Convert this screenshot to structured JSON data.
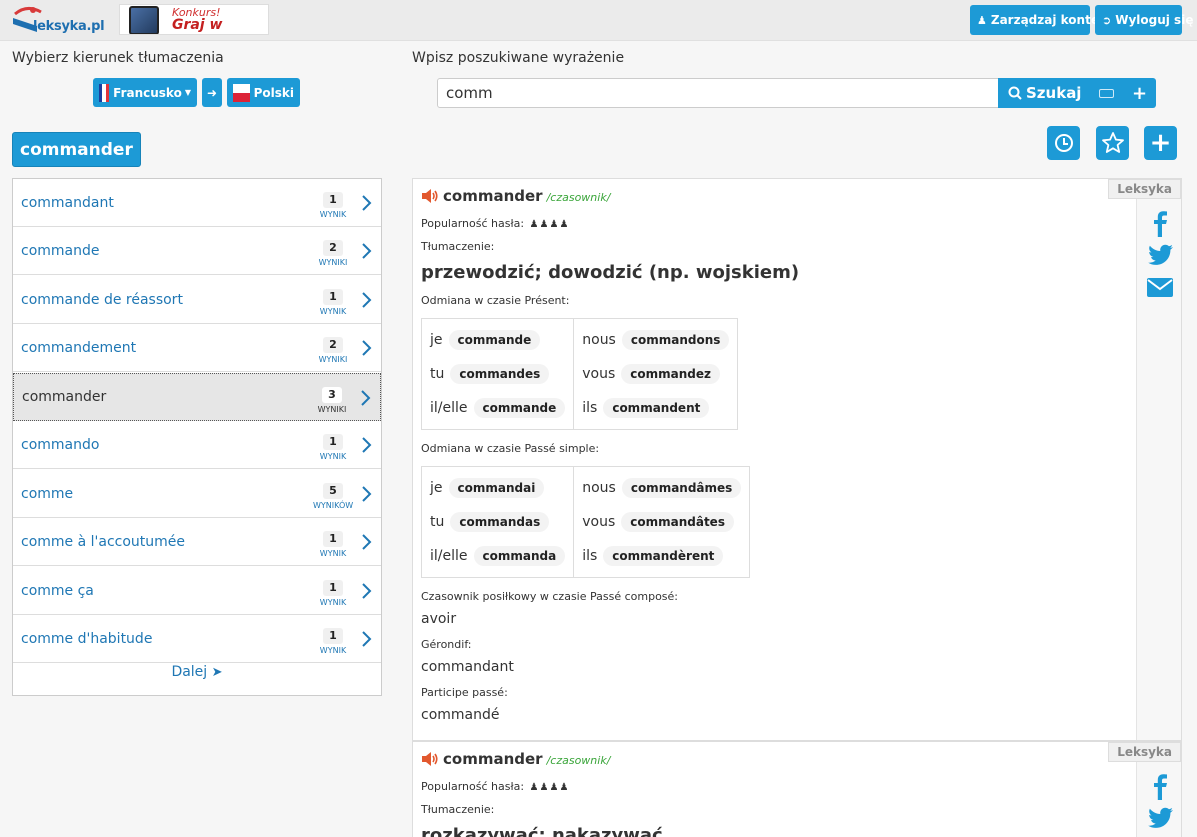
{
  "header": {
    "logo_text": "leksyka.pl",
    "banner_line1": "Konkurs!",
    "banner_line2": "Graj w języki",
    "account_button": "Zarządzaj kontem",
    "logout_button": "Wyloguj się"
  },
  "direction": {
    "label": "Wybierz kierunek tłumaczenia",
    "from_language": "Francusko",
    "to_language": "Polski"
  },
  "search": {
    "label": "Wpisz poszukiwane wyrażenie",
    "value": "comm",
    "button_label": "Szukaj"
  },
  "word_title": "commander",
  "results": [
    {
      "word": "commandant",
      "count": "1",
      "count_label": "WYNIK"
    },
    {
      "word": "commande",
      "count": "2",
      "count_label": "WYNIKI"
    },
    {
      "word": "commande de réassort",
      "count": "1",
      "count_label": "WYNIK"
    },
    {
      "word": "commandement",
      "count": "2",
      "count_label": "WYNIKI"
    },
    {
      "word": "commander",
      "count": "3",
      "count_label": "WYNIKI"
    },
    {
      "word": "commando",
      "count": "1",
      "count_label": "WYNIK"
    },
    {
      "word": "comme",
      "count": "5",
      "count_label": "WYNIKÓW"
    },
    {
      "word": "comme à l'accoutumée",
      "count": "1",
      "count_label": "WYNIK"
    },
    {
      "word": "comme ça",
      "count": "1",
      "count_label": "WYNIK"
    },
    {
      "word": "comme d'habitude",
      "count": "1",
      "count_label": "WYNIK"
    }
  ],
  "more_link": "Dalej",
  "entries": [
    {
      "source": "Leksyka",
      "word": "commander",
      "pos": "/czasownik/",
      "popularity_label": "Popularność hasła:",
      "translation_label": "Tłumaczenie:",
      "translation": "przewodzić; dowodzić (np. wojskiem)",
      "present_label": "Odmiana w czasie Présent:",
      "present": {
        "je": "commande",
        "tu": "commandes",
        "il": "commande",
        "nous": "commandons",
        "vous": "commandez",
        "ils": "commandent"
      },
      "passe_label": "Odmiana w czasie Passé simple:",
      "passe": {
        "je": "commandai",
        "tu": "commandas",
        "il": "commanda",
        "nous": "commandâmes",
        "vous": "commandâtes",
        "ils": "commandèrent"
      },
      "aux_label": "Czasownik posiłkowy w czasie Passé composé:",
      "aux": "avoir",
      "gerondif_label": "Gérondif:",
      "gerondif": "commandant",
      "participe_label": "Participe passé:",
      "participe": "commandé"
    },
    {
      "source": "Leksyka",
      "word": "commander",
      "pos": "/czasownik/",
      "popularity_label": "Popularność hasła:",
      "translation_label": "Tłumaczenie:",
      "translation": "rozkazywać; nakazywać"
    }
  ],
  "pronouns": {
    "je": "je",
    "tu": "tu",
    "il": "il/elle",
    "nous": "nous",
    "vous": "vous",
    "ils": "ils"
  },
  "colors": {
    "accent": "#1d9ad6",
    "link": "#1f77b4",
    "pos": "#3aa53a"
  }
}
